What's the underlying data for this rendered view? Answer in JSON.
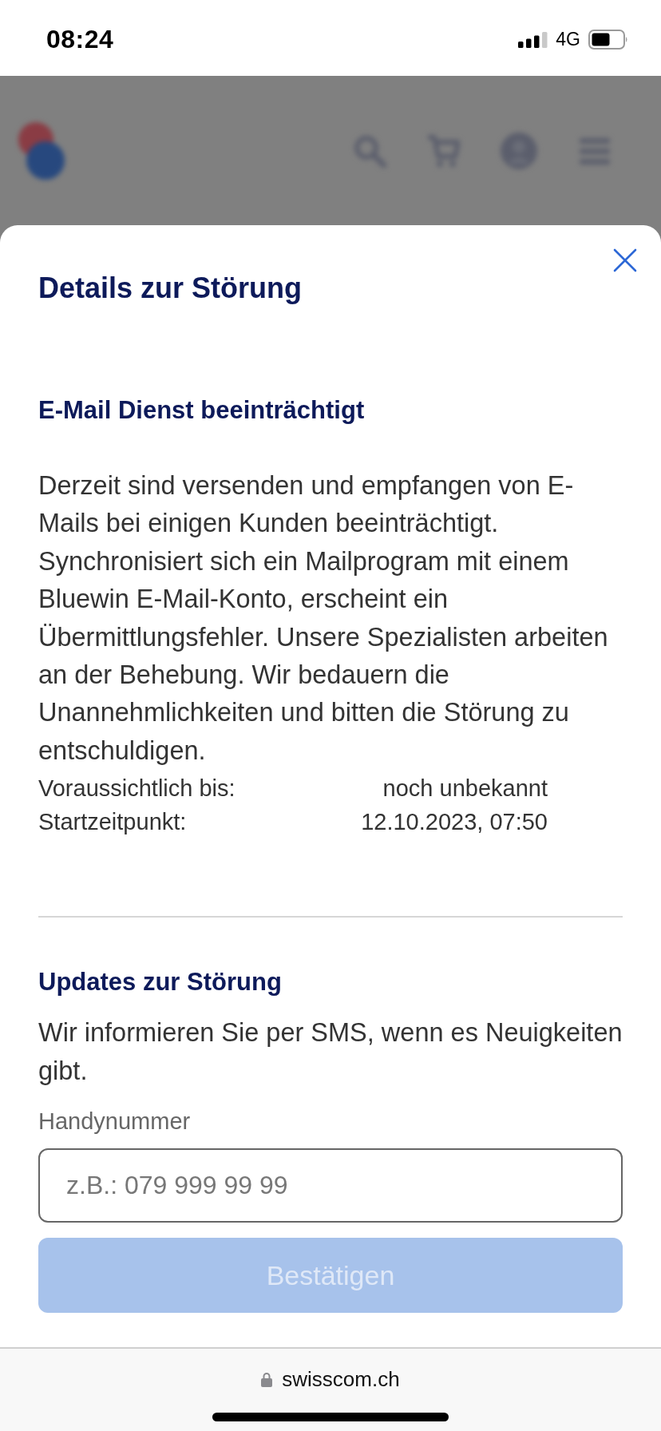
{
  "status_bar": {
    "time": "08:24",
    "network": "4G"
  },
  "sheet": {
    "title": "Details zur Störung",
    "incident": {
      "heading": "E-Mail Dienst beeinträchtigt",
      "description": "Derzeit sind versenden und empfangen von E-Mails bei einigen Kunden beeinträchtigt. Synchronisiert sich ein Mailprogram mit einem Bluewin E-Mail-Konto, erscheint ein Übermittlungsfehler. Unsere Spezialisten arbeiten an der Behebung. Wir bedauern die Unannehmlichkeiten und bitten die Störung zu entschuldigen.",
      "details": [
        {
          "label": "Voraussichtlich bis:",
          "value": "noch unbekannt"
        },
        {
          "label": "Startzeitpunkt:",
          "value": "12.10.2023, 07:50"
        }
      ]
    },
    "updates": {
      "heading": "Updates zur Störung",
      "text": "Wir informieren Sie per SMS, wenn es Neuigkeiten gibt.",
      "field_label": "Handynummer",
      "placeholder": "z.B.: 079 999 99 99",
      "button": {
        "label": "Bestätigen",
        "disabled": true
      }
    }
  },
  "browser_bar": {
    "url": "swisscom.ch"
  }
}
